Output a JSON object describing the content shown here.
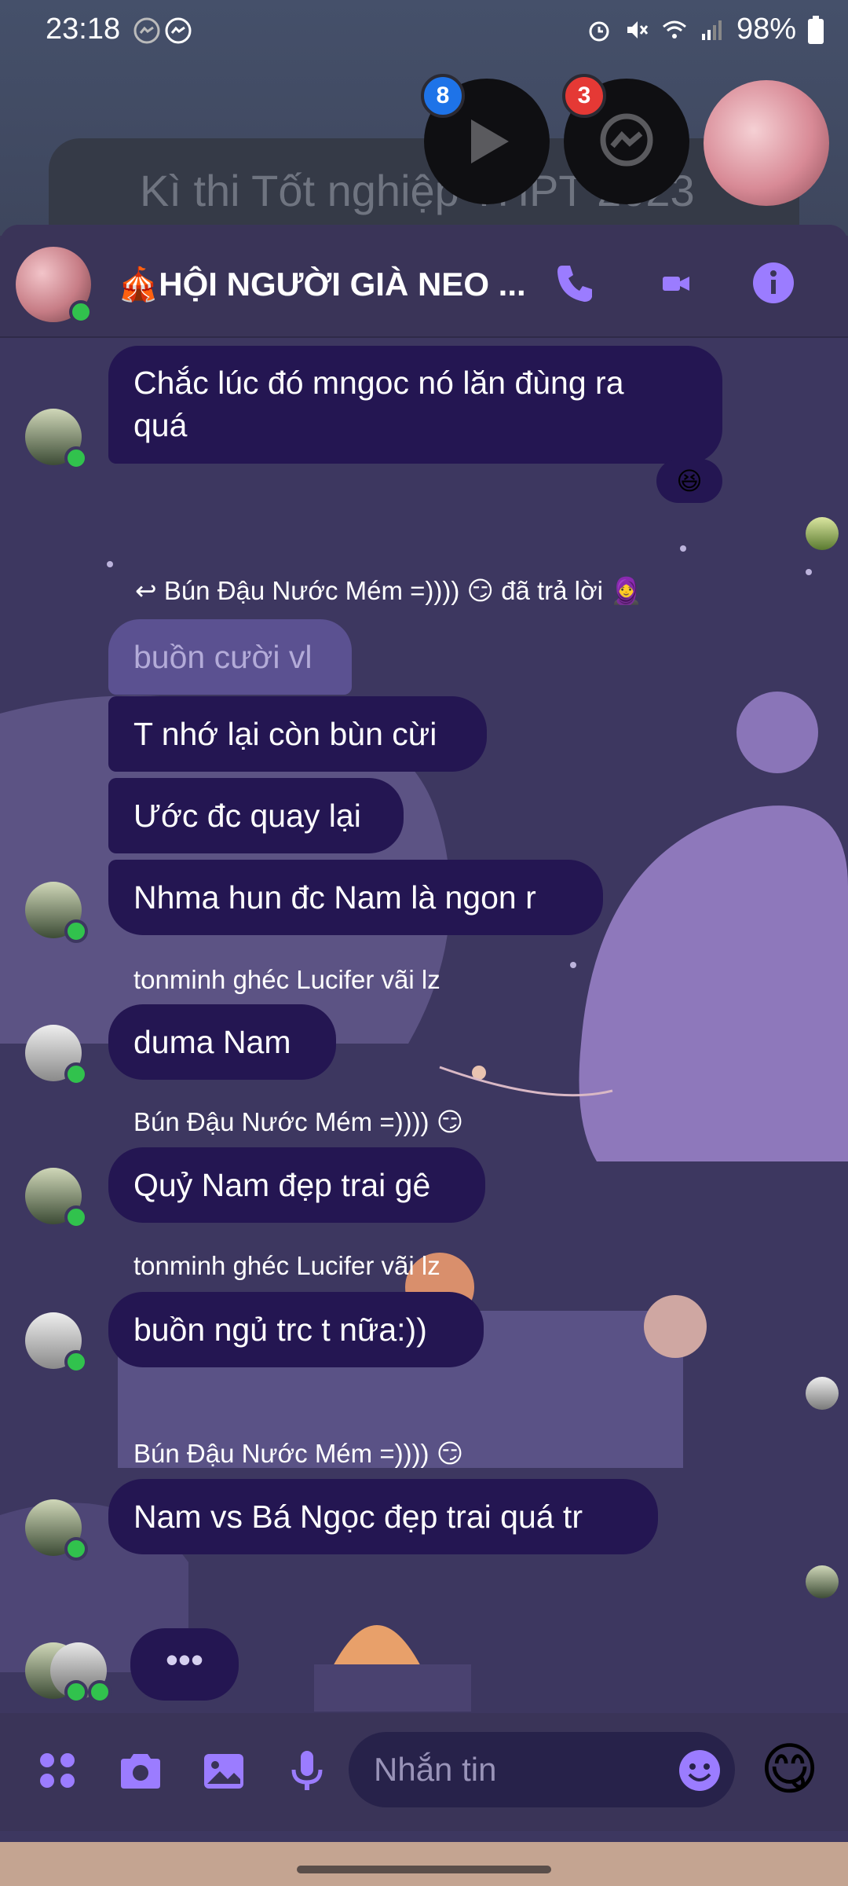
{
  "status_bar": {
    "time": "23:18",
    "battery": "98%"
  },
  "backdrop": {
    "notification_text": "Kì thi Tốt nghiệp THPT 2023"
  },
  "chat_heads": [
    {
      "name": "play-app",
      "badge": "8"
    },
    {
      "name": "messenger",
      "badge": "3"
    },
    {
      "name": "group-photo",
      "badge": ""
    }
  ],
  "header": {
    "title": "🎪HỘI NGƯỜI GIÀ NEO ..."
  },
  "messages": {
    "m1": "Chắc lúc đó mngoc nó lăn đùng ra quá",
    "m1_line1": "Chắc lúc đó mngoc nó lăn đùng ra",
    "m1_line2": "quá",
    "reaction": "😆",
    "reply_note": "↩ Bún Đậu Nước Mém =)))) 😏 đã trả lời 🧕",
    "quoted": "buồn cười vl",
    "m2": "T nhớ lại còn bùn cừi",
    "m3": "Ước đc quay lại",
    "m4": "Nhma hun đc Nam là ngon r",
    "sender1": "tonminh ghéc Lucifer vãi lz",
    "m5": "duma Nam",
    "sender2": "Bún Đậu Nước Mém =)))) 😏",
    "m6": "Quỷ Nam đẹp trai gê",
    "sender3": "tonminh ghéc Lucifer vãi lz",
    "m7": "buồn ngủ trc t nữa:))",
    "sender4": "Bún Đậu Nước Mém =)))) 😏",
    "m8": "Nam vs Bá Ngọc đẹp trai quá tr",
    "typing": "•••"
  },
  "composer": {
    "placeholder": "Nhắn tin",
    "emoji_button": "😋"
  },
  "colors": {
    "bubble": "#241652",
    "accent": "#9b7cff",
    "panel": "#3d3760",
    "online": "#31c24d"
  },
  "icons": [
    "apps-icon",
    "camera-icon",
    "image-icon",
    "microphone-icon",
    "emoji-icon",
    "phone-icon",
    "video-icon",
    "info-icon"
  ]
}
